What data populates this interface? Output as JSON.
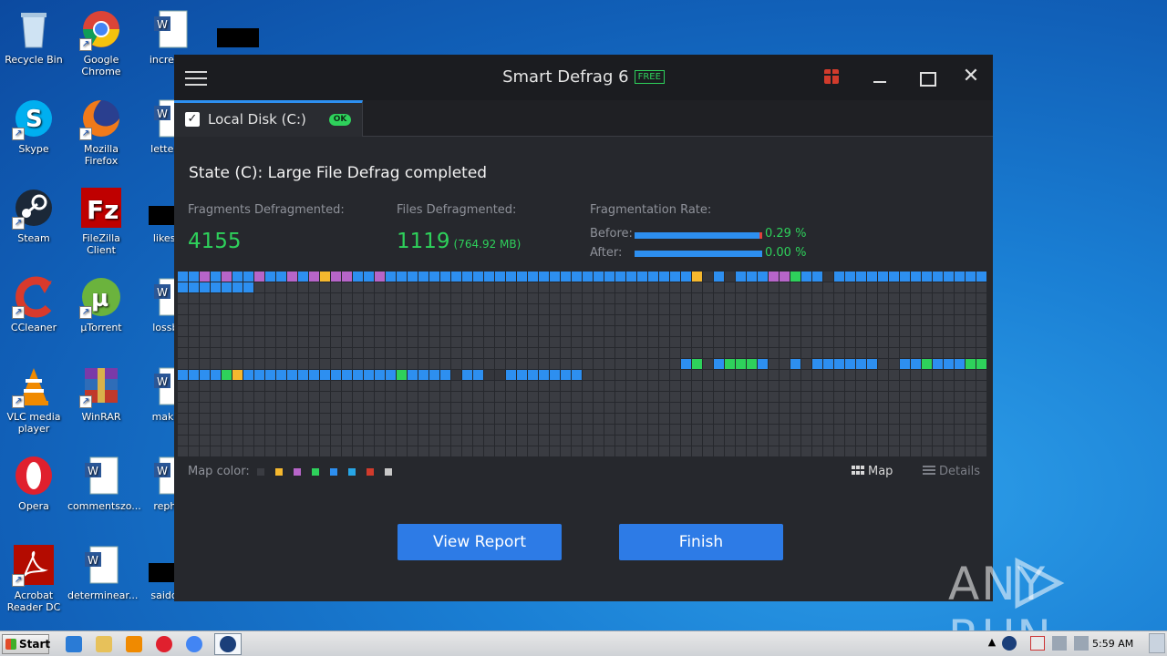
{
  "desktop": {
    "icons": [
      {
        "label": "Recycle Bin",
        "icon": "recycle-bin-icon"
      },
      {
        "label": "Google Chrome",
        "icon": "chrome-icon"
      },
      {
        "label": "increase",
        "icon": "word-doc-icon"
      },
      {
        "label": "Skype",
        "icon": "skype-icon"
      },
      {
        "label": "Mozilla Firefox",
        "icon": "firefox-icon"
      },
      {
        "label": "letterun",
        "icon": "word-doc-icon"
      },
      {
        "label": "Steam",
        "icon": "steam-icon"
      },
      {
        "label": "FileZilla Client",
        "icon": "filezilla-icon"
      },
      {
        "label": "likeson",
        "icon": "word-doc-icon"
      },
      {
        "label": "CCleaner",
        "icon": "ccleaner-icon"
      },
      {
        "label": "µTorrent",
        "icon": "utorrent-icon"
      },
      {
        "label": "lossbar",
        "icon": "word-doc-icon"
      },
      {
        "label": "VLC media player",
        "icon": "vlc-icon"
      },
      {
        "label": "WinRAR",
        "icon": "winrar-icon"
      },
      {
        "label": "making",
        "icon": "word-doc-icon"
      },
      {
        "label": "Opera",
        "icon": "opera-icon"
      },
      {
        "label": "commentszo...",
        "icon": "word-doc-icon"
      },
      {
        "label": "rephys",
        "icon": "word-doc-icon"
      },
      {
        "label": "Acrobat Reader DC",
        "icon": "acrobat-icon"
      },
      {
        "label": "determinear...",
        "icon": "word-doc-icon"
      },
      {
        "label": "saiddefi",
        "icon": "word-doc-icon"
      }
    ]
  },
  "app": {
    "title": "Smart Defrag 6",
    "badge": "FREE",
    "tab": {
      "label": "Local Disk (C:)",
      "status": "OK",
      "checked": true
    },
    "state": "State (C): Large File Defrag completed",
    "fragments_label": "Fragments Defragmented:",
    "fragments_value": "4155",
    "files_label": "Files Defragmented:",
    "files_value": "1119",
    "files_size": "(764.92 MB)",
    "rate_label": "Fragmentation Rate:",
    "before_label": "Before:",
    "before_value": "0.29 %",
    "before_fraction": 0.0029,
    "after_label": "After:",
    "after_value": "0.00 %",
    "after_fraction": 0.0,
    "map_color_label": "Map color:",
    "map_colors": [
      "#3a3c42",
      "#f5b82e",
      "#b765c9",
      "#2ed15b",
      "#2d8ff0",
      "#27a6e6",
      "#d13b2c",
      "#c8c8c8"
    ],
    "view_map_label": "Map",
    "view_details_label": "Details",
    "view_report_label": "View Report",
    "finish_label": "Finish"
  },
  "disk_map": {
    "columns": 74,
    "rows": 17,
    "colors": {
      "0": "#3a3c42",
      "B": "#2d8ff0",
      "P": "#b765c9",
      "Y": "#f5b82e",
      "G": "#2ed15b",
      "D": "#34363c"
    },
    "rows_data": [
      "BBPBPBBPBBPBPYPPBBPBBBBBBBBBBBBBBBBBBBBBBBBBBBBYDBDBBBPPGBBDBBBBBBBBBBBBBB",
      "BBBBBBB00000000000000000000000000000000000000000000000000000000000000000000",
      "00000000000000000000000000000000000000000000000000000000000000000000000000",
      "00000000000000000000000000000000000000000000000000000000000000000000000000",
      "00000000000000000000000000000000000000000000000000000000000000000000000000",
      "00000000000000000000000000000000000000000000000000000000000000000000000000",
      "00000000000000000000000000000000000000000000000000000000000000000000000000",
      "00000000000000000000000000000000000000000000000000000000000000000000000000",
      "0000000000000000000000000000000000000000000000BG0BGGGB00B0BBBBBB00BBGBBBGGG",
      "BBBBGYBBBBBBBBBBBBBBGBBBBDBBDDBBBBBBB000000000000000000000000000000000000000",
      "00000000000000000000000000000000000000000000000000000000000000000000000000",
      "00000000000000000000000000000000000000000000000000000000000000000000000000",
      "00000000000000000000000000000000000000000000000000000000000000000000000000",
      "00000000000000000000000000000000000000000000000000000000000000000000000000",
      "00000000000000000000000000000000000000000000000000000000000000000000000000",
      "00000000000000000000000000000000000000000000000000000000000000000000000000",
      "00000000000000000000000000000000000000000000000000000000000000000000000000"
    ]
  },
  "watermark": "ANY RUN",
  "taskbar": {
    "start_label": "Start",
    "clock": "5:59 AM"
  }
}
